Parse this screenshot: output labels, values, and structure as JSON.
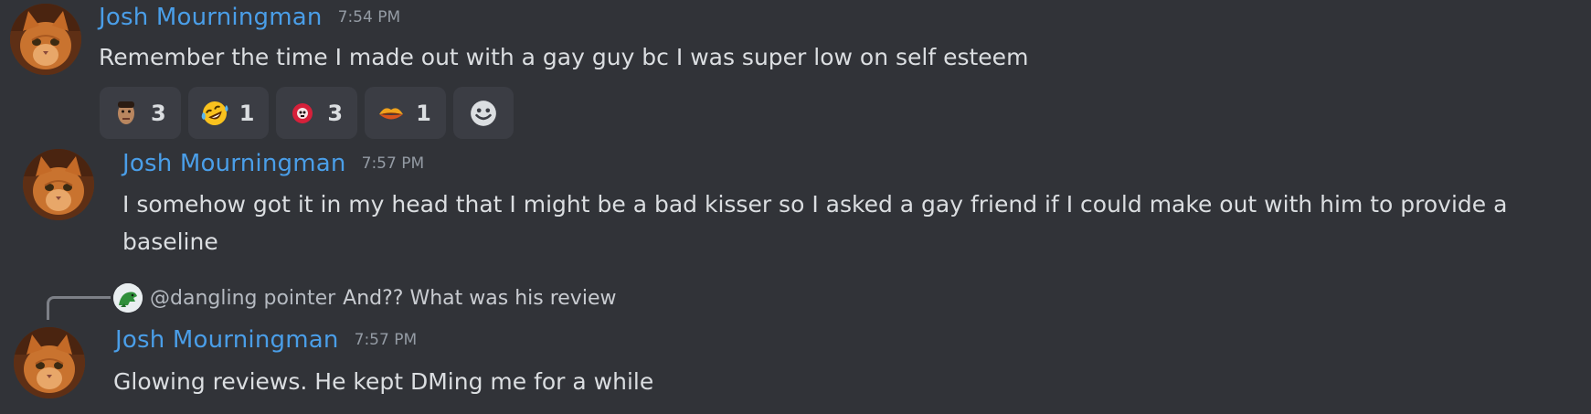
{
  "messages": [
    {
      "author": "Josh Mourningman",
      "time": "7:54 PM",
      "text": "Remember the time I made out with a gay guy bc I was super low on self esteem",
      "avatar_icon": "cat-avatar-icon",
      "reactions": [
        {
          "emoji": "custom-face-emoji",
          "count": "3"
        },
        {
          "emoji": "rolling-laughing-emoji",
          "count": "1"
        },
        {
          "emoji": "custom-red-skull-emoji",
          "count": "3"
        },
        {
          "emoji": "custom-lips-emoji",
          "count": "1"
        }
      ],
      "add_reaction_icon": "smiley-add-reaction-icon"
    },
    {
      "author": "Josh Mourningman",
      "time": "7:57 PM",
      "text": "I somehow got it in my head that I might be a bad kisser so I asked a gay friend if I could make out with him to provide a baseline",
      "avatar_icon": "cat-avatar-icon"
    },
    {
      "author": "Josh Mourningman",
      "time": "7:57 PM",
      "text": "Glowing reviews. He kept DMing me for a while",
      "avatar_icon": "cat-avatar-icon",
      "reply_to": {
        "mention": "@dangling pointer",
        "text": "And?? What was his review",
        "avatar_icon": "dinosaur-avatar-icon"
      }
    }
  ],
  "colors": {
    "background": "#313338",
    "author": "#4a9ee8",
    "timestamp": "#949ba4",
    "text": "#dbdee1",
    "reaction_bg": "#3b3d44"
  }
}
